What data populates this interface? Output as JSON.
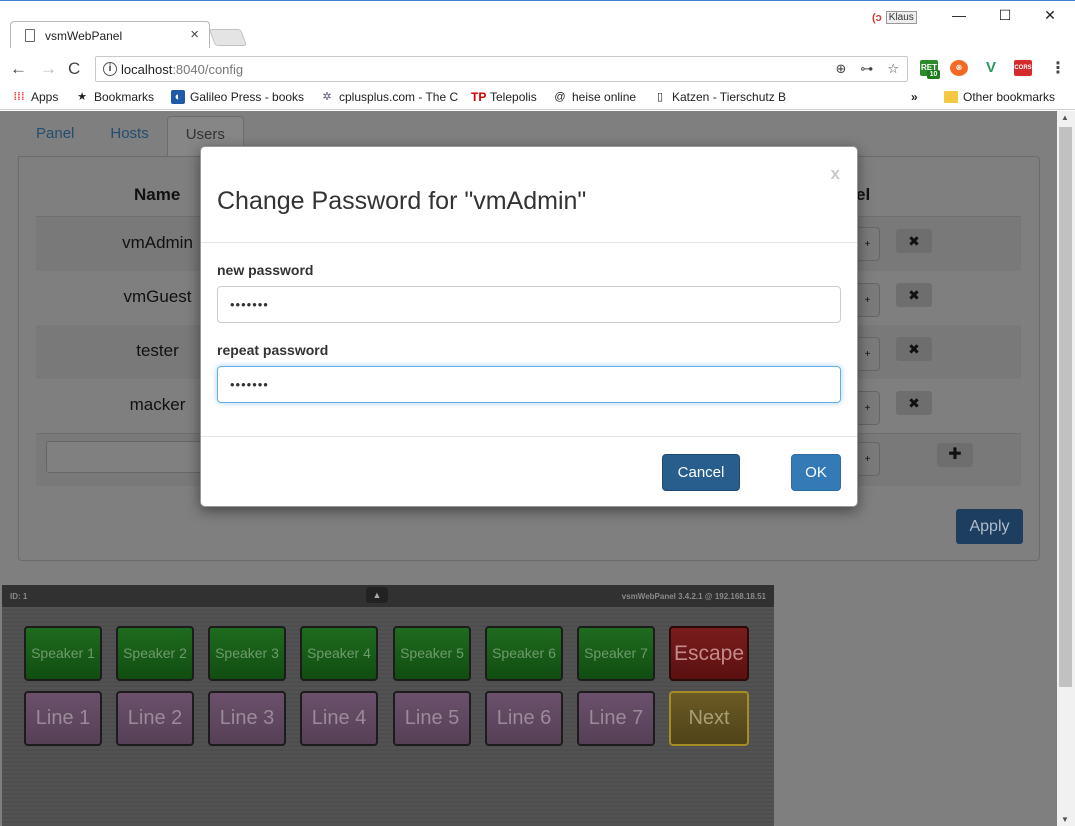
{
  "browser": {
    "tab_title": "vsmWebPanel",
    "tab_close": "×",
    "user_name": "Klaus",
    "user_icon": "(ↄ",
    "window": {
      "minimize": "—",
      "maximize": "☐",
      "close": "✕"
    },
    "url_host": "localhost",
    "url_path": ":8040/config",
    "omni_icons": {
      "zoom": "⊕",
      "key": "⊶",
      "star": "☆"
    },
    "extensions": [
      {
        "name": "extension-ret",
        "label": "RET",
        "badge": "10",
        "color": "#2d8a2d"
      },
      {
        "name": "extension-orange",
        "label": "⊗",
        "color": "#f36a24"
      },
      {
        "name": "extension-vue",
        "label": "V",
        "color": "#2c9a5e"
      },
      {
        "name": "extension-cors",
        "label": "CORS",
        "color": "#d12b2b"
      }
    ],
    "menu": "⋮",
    "bookmarks": {
      "apps": "Apps",
      "items": [
        "Bookmarks",
        "Galileo Press - books",
        "cplusplus.com - The C",
        "Telepolis",
        "heise online",
        "Katzen - Tierschutz B"
      ],
      "overflow": "»",
      "other": "Other bookmarks"
    }
  },
  "page": {
    "tabs": [
      "Panel",
      "Hosts",
      "Users"
    ],
    "active_tab": "Users",
    "table_headers": {
      "name": "Name",
      "level_partial": "el"
    },
    "users": [
      "vmAdmin",
      "vmGuest",
      "tester",
      "macker"
    ],
    "row_button": "+",
    "delete_icon": "✖",
    "add_icon": "✚",
    "apply_label": "Apply"
  },
  "vsm_panel": {
    "id_label": "ID: 1",
    "toggle_icon": "▲",
    "version": "vsmWebPanel 3.4.2.1 @ 192.168.18.51",
    "row1": [
      "Speaker 1",
      "Speaker 2",
      "Speaker 3",
      "Speaker 4",
      "Speaker 5",
      "Speaker 6",
      "Speaker 7",
      "Escape"
    ],
    "row2": [
      "Line 1",
      "Line 2",
      "Line 3",
      "Line 4",
      "Line 5",
      "Line 6",
      "Line 7",
      "Next"
    ],
    "colors": {
      "speaker": "#1f6b1f",
      "line": "#6b506b",
      "escape": "#7a1c1c",
      "next": "#6a5a25"
    }
  },
  "modal": {
    "title": "Change Password for \"vmAdmin\"",
    "close": "x",
    "new_password_label": "new password",
    "new_password_value": "•••••••",
    "repeat_password_label": "repeat password",
    "repeat_password_value": "•••••••",
    "cancel_label": "Cancel",
    "ok_label": "OK"
  },
  "colors": {
    "primary": "#337ab7",
    "primary_dark": "#285e8e",
    "focus": "#66afe9"
  }
}
